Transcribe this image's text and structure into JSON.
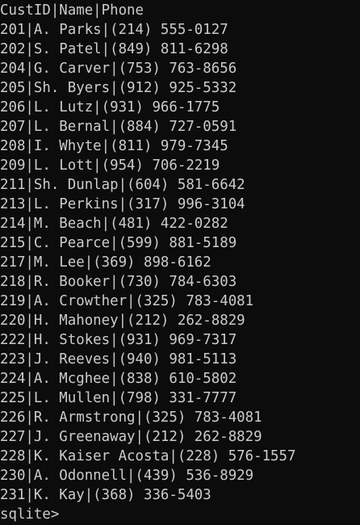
{
  "terminal": {
    "header": "CustID|Name|Phone",
    "rows": [
      "201|A. Parks|(214) 555-0127",
      "202|S. Patel|(849) 811-6298",
      "204|G. Carver|(753) 763-8656",
      "205|Sh. Byers|(912) 925-5332",
      "206|L. Lutz|(931) 966-1775",
      "207|L. Bernal|(884) 727-0591",
      "208|I. Whyte|(811) 979-7345",
      "209|L. Lott|(954) 706-2219",
      "211|Sh. Dunlap|(604) 581-6642",
      "213|L. Perkins|(317) 996-3104",
      "214|M. Beach|(481) 422-0282",
      "215|C. Pearce|(599) 881-5189",
      "217|M. Lee|(369) 898-6162",
      "218|R. Booker|(730) 784-6303",
      "219|A. Crowther|(325) 783-4081",
      "220|H. Mahoney|(212) 262-8829",
      "222|H. Stokes|(931) 969-7317",
      "223|J. Reeves|(940) 981-5113",
      "224|A. Mcghee|(838) 610-5802",
      "225|L. Mullen|(798) 331-7777",
      "226|R. Armstrong|(325) 783-4081",
      "227|J. Greenaway|(212) 262-8829",
      "228|K. Kaiser Acosta|(228) 576-1557",
      "230|A. Odonnell|(439) 536-8929",
      "231|K. Kay|(368) 336-5403"
    ],
    "prompt": "sqlite>"
  }
}
